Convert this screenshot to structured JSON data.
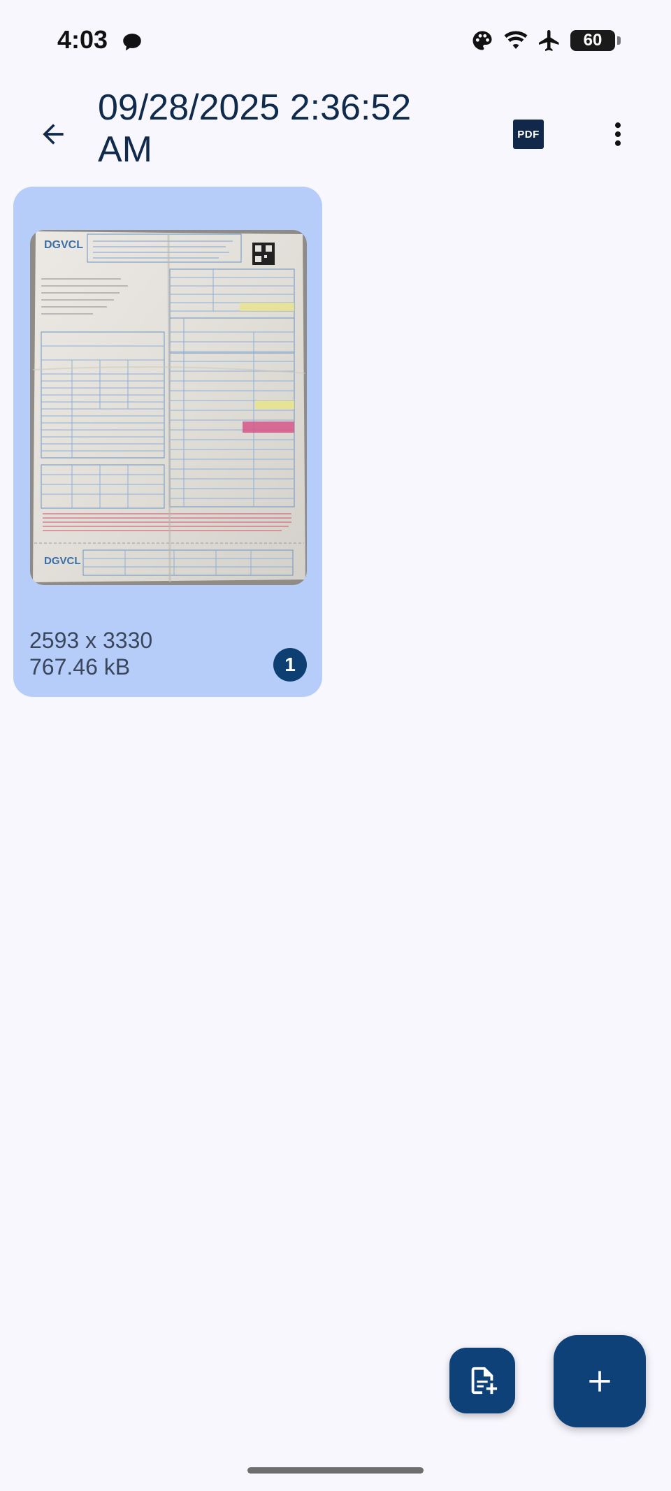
{
  "status_bar": {
    "time": "4:03",
    "battery": "60",
    "icons": [
      "messages-icon",
      "palette-icon",
      "wifi-icon",
      "airplane-mode-icon",
      "battery-icon"
    ]
  },
  "app_bar": {
    "title": "09/28/2025 2:36:52 AM",
    "pdf_label": "PDF",
    "icons": [
      "back-arrow-icon",
      "pdf-icon",
      "more-vert-icon"
    ]
  },
  "pages": [
    {
      "dimensions": "2593 x 3330",
      "size": "767.46 kB",
      "number": "1",
      "thumbnail_logo": "DGVCL"
    }
  ],
  "fabs": {
    "small_icon": "add-document-icon",
    "large_icon": "plus-icon"
  },
  "colors": {
    "background": "#f8f7fe",
    "card": "#b7cdf9",
    "accent": "#0d4177",
    "title": "#0f2a4a"
  }
}
